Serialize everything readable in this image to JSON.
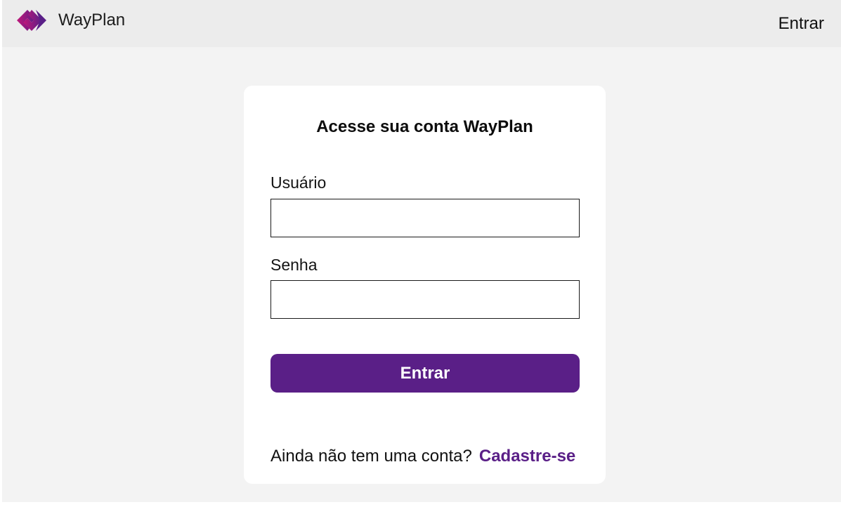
{
  "header": {
    "brand_name": "WayPlan",
    "login_link": "Entrar",
    "logo_icon": "interlocked-diamond-logo-icon"
  },
  "login_card": {
    "title": "Acesse sua conta WayPlan",
    "username_label": "Usuário",
    "username_value": "",
    "password_label": "Senha",
    "password_value": "",
    "submit_label": "Entrar",
    "signup_prompt": "Ainda não tem uma conta?",
    "signup_link": "Cadastre-se"
  },
  "colors": {
    "accent": "#5a1f87",
    "logo_gradient_start": "#5a1f87",
    "logo_gradient_end": "#c0187a",
    "header_background": "#ececec",
    "page_background": "#f3f3f3",
    "card_background": "#ffffff"
  }
}
